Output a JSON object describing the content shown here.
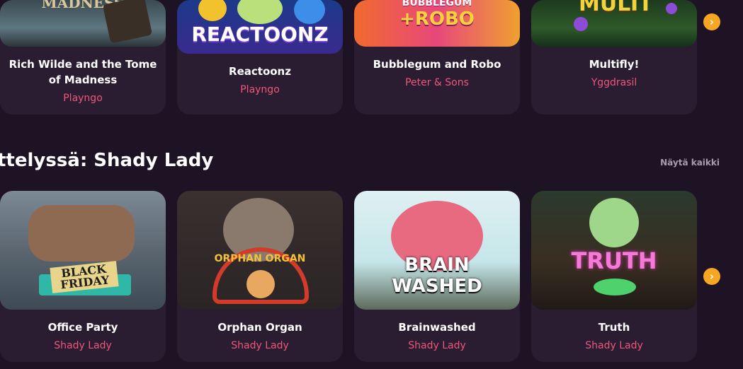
{
  "row1": {
    "cards": [
      {
        "title": "Rich Wilde and the Tome of Madness",
        "provider": "Playngo",
        "art": "MADNESS"
      },
      {
        "title": "Reactoonz",
        "provider": "Playngo",
        "art": "REACTOONZ"
      },
      {
        "title": "Bubblegum and Robo",
        "provider": "Peter & Sons",
        "art1": "BUBBLEGUM",
        "art2": "+ROBO"
      },
      {
        "title": "Multifly!",
        "provider": "Yggdrasil",
        "art": "MULTI"
      }
    ]
  },
  "section": {
    "title": "ttelyssä: Shady Lady",
    "see_all": "Näytä kaikki"
  },
  "row2": {
    "cards": [
      {
        "title": "Office Party",
        "provider": "Shady Lady",
        "art": "BLACK FRIDAY"
      },
      {
        "title": "Orphan Organ",
        "provider": "Shady Lady",
        "art": "ORPHAN ORGAN"
      },
      {
        "title": "Brainwashed",
        "provider": "Shady Lady",
        "art1": "BRAIN",
        "art2": "WASHED"
      },
      {
        "title": "Truth",
        "provider": "Shady Lady",
        "art": "TRUTH"
      }
    ]
  },
  "icons": {
    "next": "chevron-right-icon"
  },
  "colors": {
    "accent": "#f5a623",
    "provider": "#f0567a",
    "background": "#1e1325"
  }
}
